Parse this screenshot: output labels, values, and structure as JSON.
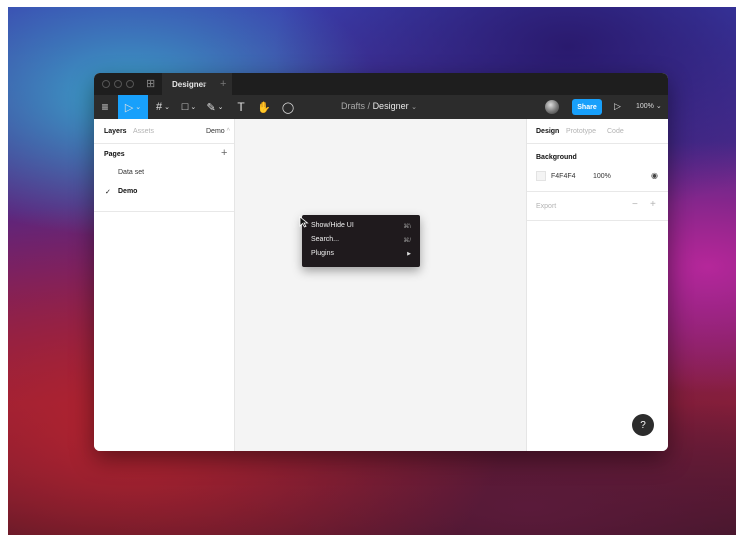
{
  "window": {
    "tab_icon": "figma-icon",
    "tab_title": "Designer",
    "tab_close": "×",
    "new_tab": "+"
  },
  "toolbar": {
    "menu_icon": "≡",
    "move_icon": "▷",
    "frame_icon": "#",
    "shape_icon": "□",
    "pen_icon": "✎",
    "text_icon": "T",
    "hand_icon": "✋",
    "comment_icon": "◯",
    "caret": "⌄",
    "breadcrumb_parent": "Drafts",
    "breadcrumb_sep": "/",
    "breadcrumb_file": "Designer",
    "share_label": "Share",
    "play_icon": "▷",
    "zoom": "100%"
  },
  "left_panel": {
    "tab_layers": "Layers",
    "tab_assets": "Assets",
    "page_selector": "Demo",
    "pages_label": "Pages",
    "add_icon": "+",
    "pages": [
      {
        "label": "Data set",
        "check": ""
      },
      {
        "label": "Demo",
        "check": "✓"
      }
    ]
  },
  "context_menu": {
    "items": [
      {
        "label": "Show/Hide UI",
        "shortcut": "⌘\\"
      },
      {
        "label": "Search...",
        "shortcut": "⌘/"
      },
      {
        "label": "Plugins",
        "shortcut": "▶"
      }
    ]
  },
  "right_panel": {
    "tab_design": "Design",
    "tab_prototype": "Prototype",
    "tab_code": "Code",
    "background_label": "Background",
    "bg_color": "F4F4F4",
    "bg_opacity": "100%",
    "eye_icon": "◉",
    "export_label": "Export",
    "minus_icon": "−",
    "plus_icon": "+"
  },
  "help": {
    "label": "?"
  },
  "colors": {
    "accent": "#18a0fb",
    "canvas": "#f4f4f4",
    "toolbar": "#2c2c2c",
    "titlebar": "#1e1e1e"
  }
}
